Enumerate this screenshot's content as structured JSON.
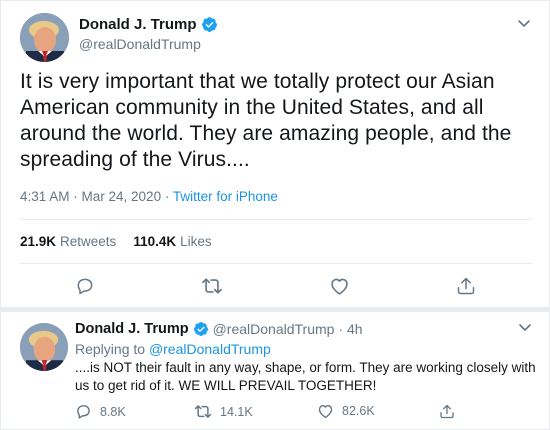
{
  "colors": {
    "accent": "#1b95e0",
    "text": "#14171a",
    "muted": "#657786",
    "border": "#e6ecf0",
    "verified": "#1da1f2"
  },
  "main_tweet": {
    "display_name": "Donald J. Trump",
    "handle": "@realDonaldTrump",
    "text": "It is very important that we totally protect our Asian American community in the United States, and all around the world. They are amazing people, and the spreading of the Virus....",
    "time": "4:31 AM · Mar 24, 2020",
    "meta_sep": " · ",
    "source": "Twitter for iPhone",
    "retweets_count": "21.9K",
    "retweets_label": "Retweets",
    "likes_count": "110.4K",
    "likes_label": "Likes",
    "icons": [
      "chevron-down-icon",
      "verified-badge-icon",
      "reply-icon",
      "retweet-icon",
      "like-icon",
      "share-icon"
    ]
  },
  "reply_tweet": {
    "display_name": "Donald J. Trump",
    "handle": "@realDonaldTrump",
    "age": "· 4h",
    "replying_prefix": "Replying to",
    "replying_to": "@realDonaldTrump",
    "text": "....is NOT their fault in any way, shape, or form. They are working closely with us to get rid of it. WE WILL PREVAIL TOGETHER!",
    "replies": "8.8K",
    "retweets": "14.1K",
    "likes": "82.6K"
  }
}
